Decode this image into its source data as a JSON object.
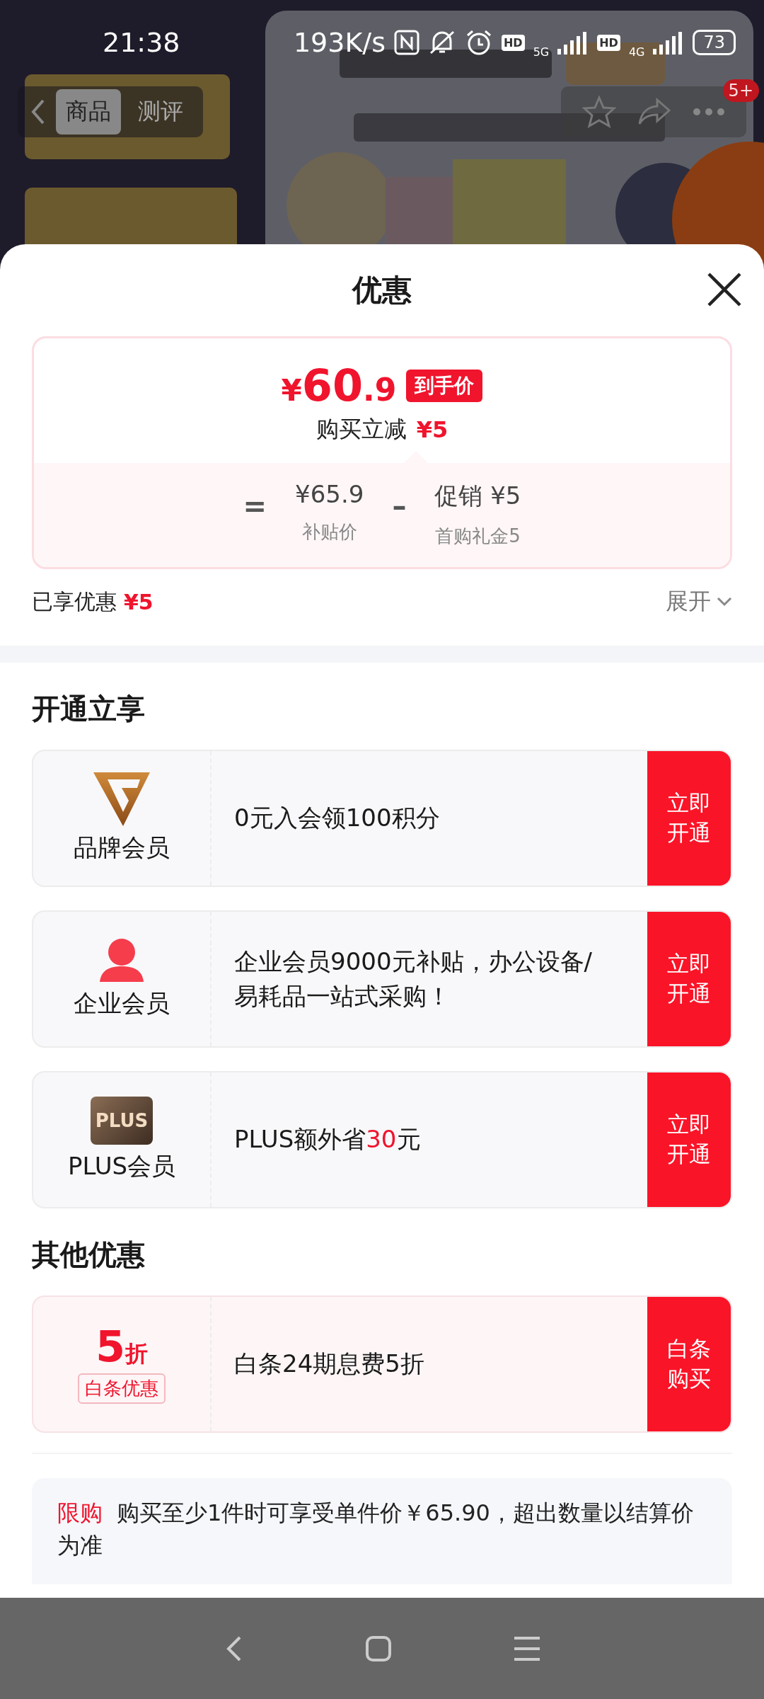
{
  "status_bar": {
    "time": "21:38",
    "net_speed": "193K/s",
    "networks": [
      {
        "hd": "HD",
        "type": "5G"
      },
      {
        "hd": "HD",
        "type": "4G"
      }
    ],
    "battery": "73"
  },
  "nav": {
    "tabs": [
      {
        "label": "商品",
        "selected": true
      },
      {
        "label": "测评",
        "selected": false
      }
    ],
    "badge": "5+"
  },
  "sheet": {
    "title": "优惠",
    "price_card": {
      "currency": "¥",
      "price_int": "60",
      "price_dec": ".9",
      "price_tag": "到手价",
      "reduce_label": "购买立减",
      "reduce_amount": "¥5",
      "equals": "=",
      "minus": "–",
      "terms": [
        {
          "value": "¥65.9",
          "label": "补贴价"
        },
        {
          "value": "促销 ¥5",
          "label": "首购礼金5"
        }
      ]
    },
    "enjoyed": {
      "label": "已享优惠",
      "amount": "¥5"
    },
    "expand": "展开",
    "sections": [
      {
        "title": "开通立享",
        "offers": [
          {
            "kind": "brand",
            "name": "品牌会员",
            "segments": [
              {
                "text": "0元入会领100积分",
                "highlight": false
              }
            ],
            "button": "立即开通"
          },
          {
            "kind": "enterprise",
            "name": "企业会员",
            "segments": [
              {
                "text": "企业会员9000元补贴，办公设备/易耗品一站式采购！",
                "highlight": false
              }
            ],
            "button": "立即开通"
          },
          {
            "kind": "plus",
            "badge": "PLUS",
            "name": "PLUS会员",
            "segments": [
              {
                "text": "PLUS额外省",
                "highlight": false
              },
              {
                "text": "30",
                "highlight": true
              },
              {
                "text": "元",
                "highlight": false
              }
            ],
            "button": "立即开通"
          }
        ]
      },
      {
        "title": "其他优惠",
        "offers": [
          {
            "kind": "discount",
            "big": "5",
            "unit": "折",
            "name": "白条优惠",
            "segments": [
              {
                "text": "白条24期息费5折",
                "highlight": false
              }
            ],
            "button": "白条购买"
          }
        ]
      }
    ],
    "note": {
      "tag": "限购",
      "text": "购买至少1件时可享受单件价￥65.90，超出数量以结算价为准"
    }
  }
}
